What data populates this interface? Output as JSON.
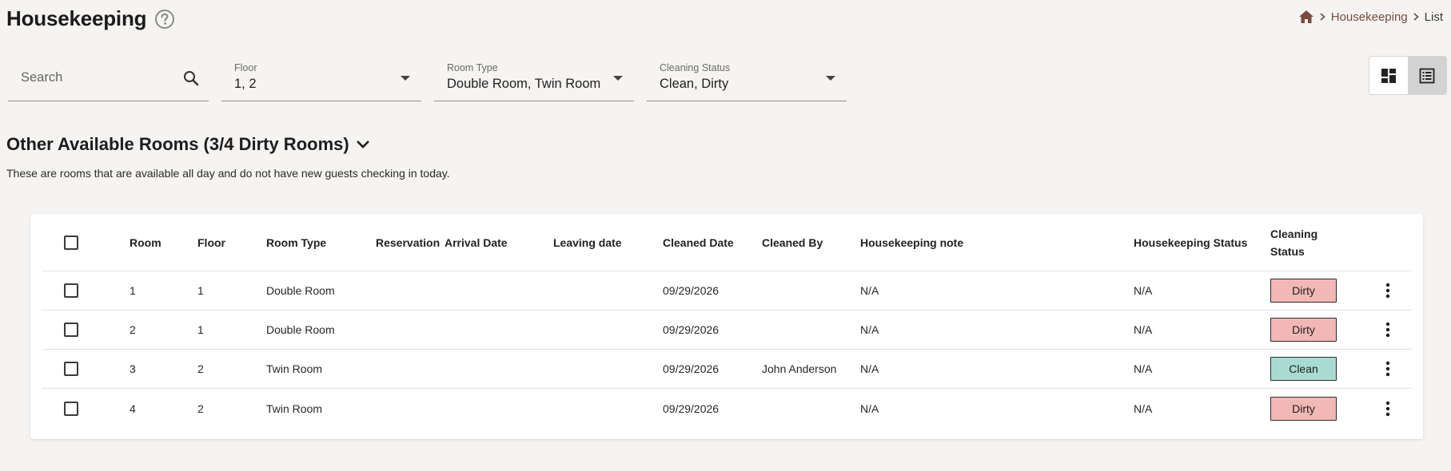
{
  "header": {
    "title": "Housekeeping",
    "breadcrumb": {
      "link": "Housekeeping",
      "current": "List"
    }
  },
  "filters": {
    "search": {
      "placeholder": "Search"
    },
    "floor": {
      "label": "Floor",
      "value": "1, 2"
    },
    "room_type": {
      "label": "Room Type",
      "value": "Double Room, Twin Room"
    },
    "cleaning_status": {
      "label": "Cleaning Status",
      "value": "Clean, Dirty"
    }
  },
  "section": {
    "title": "Other Available Rooms (3/4 Dirty Rooms)",
    "description": "These are rooms that are available all day and do not have new guests checking in today."
  },
  "table": {
    "columns": {
      "room": "Room",
      "floor": "Floor",
      "room_type": "Room Type",
      "reservation": "Reservation",
      "arrival": "Arrival Date",
      "leaving": "Leaving date",
      "cleaned_date": "Cleaned Date",
      "cleaned_by": "Cleaned By",
      "note": "Housekeeping note",
      "hk_status": "Housekeeping Status",
      "cleaning_status": "Cleaning Status"
    },
    "rows": [
      {
        "room": "1",
        "floor": "1",
        "room_type": "Double Room",
        "reservation": "",
        "arrival": "",
        "leaving": "",
        "cleaned_date": "09/29/2026",
        "cleaned_by": "",
        "note": "N/A",
        "hk_status": "N/A",
        "cleaning_status": "Dirty"
      },
      {
        "room": "2",
        "floor": "1",
        "room_type": "Double Room",
        "reservation": "",
        "arrival": "",
        "leaving": "",
        "cleaned_date": "09/29/2026",
        "cleaned_by": "",
        "note": "N/A",
        "hk_status": "N/A",
        "cleaning_status": "Dirty"
      },
      {
        "room": "3",
        "floor": "2",
        "room_type": "Twin Room",
        "reservation": "",
        "arrival": "",
        "leaving": "",
        "cleaned_date": "09/29/2026",
        "cleaned_by": "John Anderson",
        "note": "N/A",
        "hk_status": "N/A",
        "cleaning_status": "Clean"
      },
      {
        "room": "4",
        "floor": "2",
        "room_type": "Twin Room",
        "reservation": "",
        "arrival": "",
        "leaving": "",
        "cleaned_date": "09/29/2026",
        "cleaned_by": "",
        "note": "N/A",
        "hk_status": "N/A",
        "cleaning_status": "Dirty"
      }
    ]
  },
  "status_colors": {
    "Dirty": "#f2b8b5",
    "Clean": "#a8dcd1"
  },
  "accent_color": "#7a4a3f"
}
